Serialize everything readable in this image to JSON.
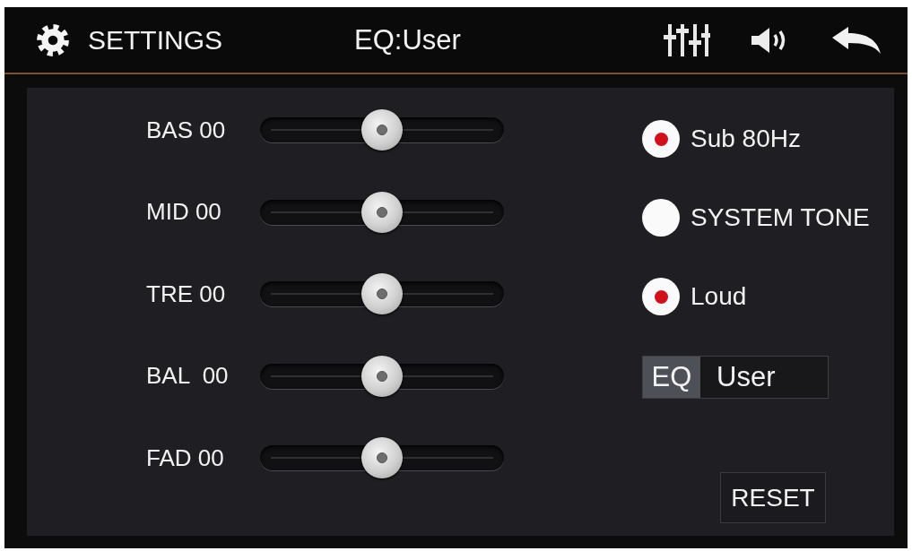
{
  "header": {
    "title": "SETTINGS",
    "mode": "EQ:User"
  },
  "sliders": [
    {
      "label": "BAS 00",
      "level": 0.5
    },
    {
      "label": "MID 00",
      "level": 0.5
    },
    {
      "label": "TRE 00",
      "level": 0.5
    },
    {
      "label": "BAL  00",
      "level": 0.5
    },
    {
      "label": "FAD 00",
      "level": 0.5
    }
  ],
  "options": [
    {
      "label": "Sub 80Hz",
      "checked": true
    },
    {
      "label": "SYSTEM TONE",
      "checked": false
    },
    {
      "label": "Loud",
      "checked": true
    }
  ],
  "eq_preset": {
    "label": "EQ",
    "value": "User"
  },
  "reset_button": {
    "label": "RESET"
  }
}
